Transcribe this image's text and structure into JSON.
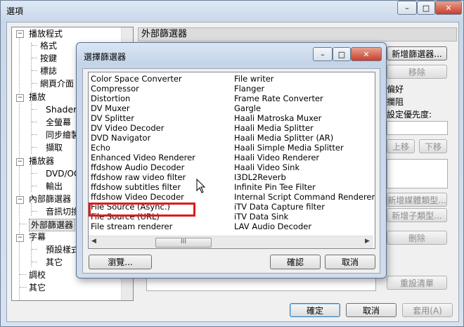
{
  "outer": {
    "title": "選項",
    "caption_min": "–",
    "caption_max": "□",
    "caption_close": "✕",
    "panel_header": "外部篩選器",
    "tree": [
      "播放程式",
      "格式",
      "按鍵",
      "標誌",
      "網頁介面",
      "播放",
      "Shaders",
      "全螢幕",
      "同步繪製",
      "擷取",
      "播放器",
      "DVD/OG",
      "輸出",
      "內部篩選器",
      "音訊切換",
      "外部篩選器",
      "字幕",
      "預設樣式",
      "其它",
      "調校",
      "其它"
    ],
    "right_buttons": {
      "add_filter": "新增篩選器...",
      "remove": "移除",
      "up": "上移",
      "down": "下移",
      "add_media_type": "新增媒體類型...",
      "add_subtype": "新增子類型...",
      "delete": "刪除",
      "reset_list": "重設清單"
    },
    "right_labels": {
      "prefer": "偏好",
      "block": "攔阻",
      "set_priority": "設定優先度:"
    },
    "bottom_buttons": {
      "ok": "確定",
      "cancel": "取消",
      "apply": "套用(A)"
    }
  },
  "dialog": {
    "title": "選擇篩選器",
    "caption_min": "–",
    "caption_max": "□",
    "caption_close": "✕",
    "list_col1": [
      "Color Space Converter",
      "Compressor",
      "Distortion",
      "DV Muxer",
      "DV Splitter",
      "DV Video Decoder",
      "DVD Navigator",
      "Echo",
      "Enhanced Video Renderer",
      "ffdshow Audio Decoder",
      "ffdshow raw video filter",
      "ffdshow subtitles filter",
      "ffdshow Video Decoder",
      "File Source (Async.)",
      "File Source (URL)",
      "File stream renderer"
    ],
    "list_col2": [
      "File writer",
      "Flanger",
      "Frame Rate Converter",
      "Gargle",
      "Haali Matroska Muxer",
      "Haali Media Splitter",
      "Haali Media Splitter (AR)",
      "Haali Simple Media Splitter",
      "Haali Video Renderer",
      "Haali Video Sink",
      "I3DL2Reverb",
      "Infinite Pin Tee Filter",
      "Internal Script Command Renderer",
      "iTV Data Capture filter",
      "iTV Data Sink",
      "LAV Audio Decoder"
    ],
    "scroll_thumb_glyph": "III",
    "scroll_left_glyph": "◀",
    "scroll_right_glyph": "▶",
    "browse_button": "瀏覽...",
    "ok_button": "確認",
    "cancel_button": "取消",
    "highlighted_item": "ffdshow raw video filter",
    "highlight_color": "#e0191f"
  }
}
